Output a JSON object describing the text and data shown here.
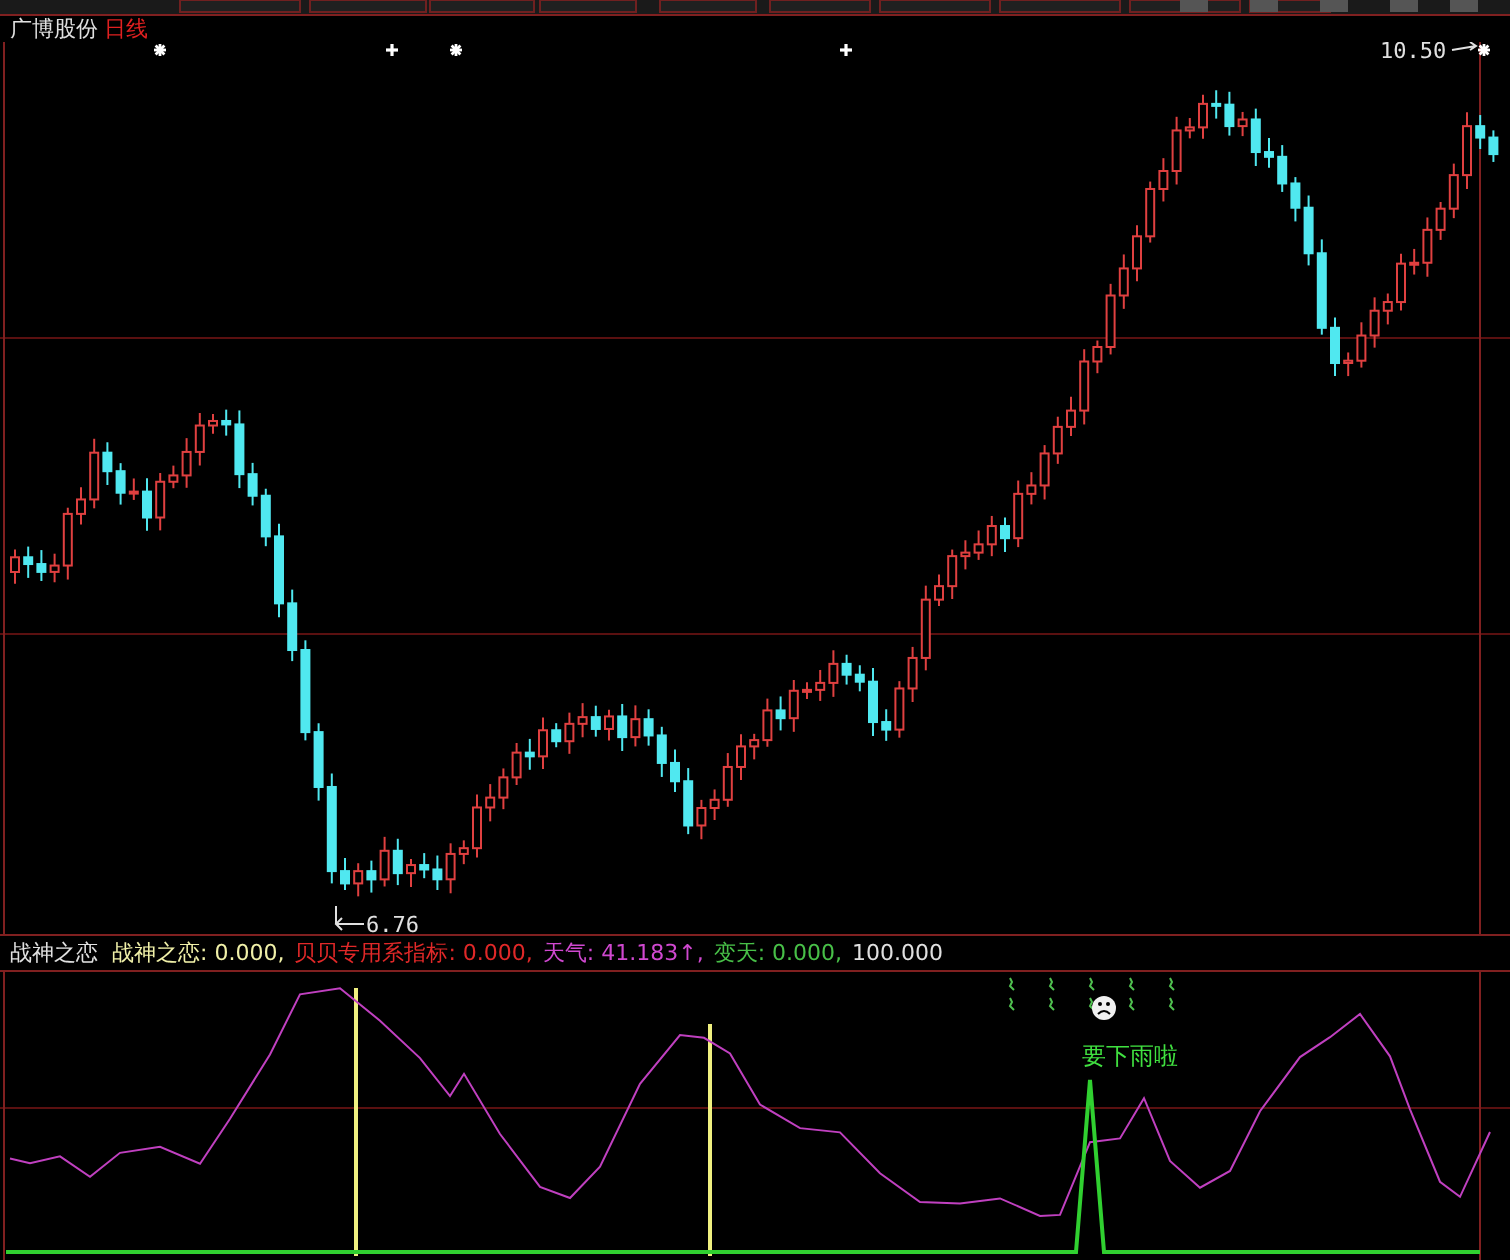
{
  "stock": {
    "name": "广博股份",
    "period": "日线"
  },
  "price_chart": {
    "high_label": "10.50",
    "low_label": "6.76",
    "markers": [
      {
        "kind": "asterisk"
      },
      {
        "kind": "plus"
      },
      {
        "kind": "asterisk"
      },
      {
        "kind": "plus"
      },
      {
        "kind": "asterisk"
      }
    ]
  },
  "indicator": {
    "name": "战神之恋",
    "readings": [
      {
        "text": "战神之恋: 0.000,",
        "color": "#f0f0a8"
      },
      {
        "text": "贝贝专用系指标: 0.000,",
        "color": "#e02828"
      },
      {
        "text": "天气: 41.183↑,",
        "color": "#d048d0"
      },
      {
        "text": "变天: 0.000,",
        "color": "#48c048"
      },
      {
        "text": "100.000",
        "color": "#e0e0e0"
      }
    ],
    "alert": "要下雨啦"
  }
}
